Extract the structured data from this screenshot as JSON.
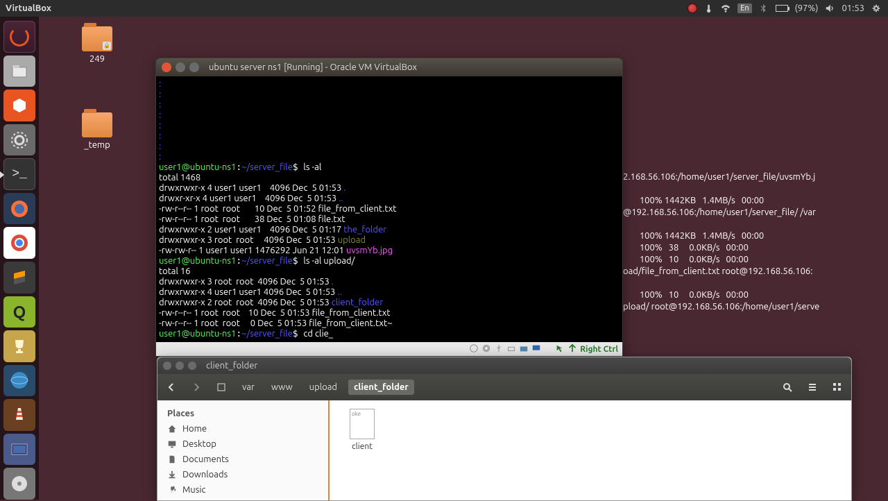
{
  "menubar": {
    "app": "VirtualBox",
    "lang": "En",
    "battery_pct": "(97%)",
    "time": "01:53"
  },
  "desktop": {
    "icon1_label": "249",
    "icon2_label": "_temp"
  },
  "vb": {
    "title": "ubuntu server ns1 [Running] - Oracle VM VirtualBox",
    "prompt_user": "user1@ubuntu-ns1",
    "prompt_path": "~/server_file",
    "cmd1": "ls -al",
    "total1": "total 1468",
    "l1": "drwxrwxr-x 4 user1 user1    4096 Dec  5 01:53 ",
    "l1d": ".",
    "l2": "drwxr-xr-x 4 user1 user1    4096 Dec  5 01:53 ",
    "l2d": "..",
    "l3": "-rw-r--r-- 1 root  root       10 Dec  5 01:52 file_from_client.txt",
    "l4": "-rw-r--r-- 1 root  root       38 Dec  5 01:08 file.txt",
    "l5": "drwxrwxr-x 2 user1 user1    4096 Dec  5 01:17 ",
    "l5d": "the_folder",
    "l6": "drwxrwxr-x 3 root  root     4096 Dec  5 01:53 ",
    "l6d": "upload",
    "l7": "-rw-rw-r-- 1 user1 user1 1476292 Jun 21 12:01 ",
    "l7d": "uvsmYb.jpg",
    "cmd2": "ls -al upload/",
    "total2": "total 16",
    "u1": "drwxrwxr-x 3 root  root  4096 Dec  5 01:53 ",
    "u1d": ".",
    "u2": "drwxrwxr-x 4 user1 user1 4096 Dec  5 01:53 ",
    "u2d": "..",
    "u3": "drwxrwxr-x 2 root  root  4096 Dec  5 01:53 ",
    "u3d": "client_folder",
    "u4": "-rw-r--r-- 1 root  root    10 Dec  5 01:53 file_from_client.txt",
    "u5": "-rw-r--r-- 1 root  root     0 Dec  5 01:53 file_from_client.txt~",
    "cmd3": "cd clie_",
    "host_key": "Right Ctrl"
  },
  "bg_term": {
    "l1": "2.168.56.106:/home/user1/server_file/uvsmYb.j",
    "l2": "        100% 1442KB   1.4MB/s   00:00",
    "l3": "@192.168.56.106:/home/user1/server_file/ /var",
    "l4": "        100% 1442KB   1.4MB/s   00:00",
    "l5": "        100%   38     0.0KB/s   00:00",
    "l6": "        100%   10     0.0KB/s   00:00",
    "l7": "oad/file_from_client.txt root@192.168.56.106:",
    "l8": "        100%   10     0.0KB/s   00:00",
    "l9": "pload/ root@192.168.56.106:/home/user1/serve"
  },
  "fm": {
    "title": "client_folder",
    "path": [
      "var",
      "www",
      "upload",
      "client_folder"
    ],
    "sidebar_header": "Places",
    "sidebar": {
      "home": "Home",
      "desktop": "Desktop",
      "documents": "Documents",
      "downloads": "Downloads",
      "music": "Music"
    },
    "file_preview": "oke",
    "file_name": "client"
  }
}
